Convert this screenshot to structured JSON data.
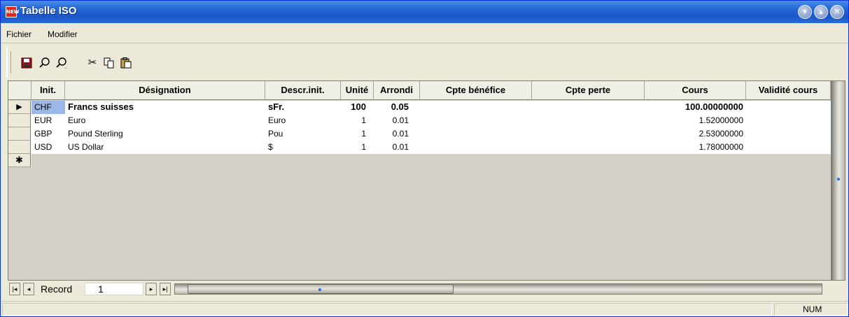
{
  "window": {
    "title": "Tabelle ISO",
    "icon_text": "NEW"
  },
  "menu": {
    "items": [
      "Fichier",
      "Modifier"
    ]
  },
  "toolbar": {
    "buttons": [
      "save-icon",
      "find-icon",
      "find-next-icon",
      "cut-icon",
      "copy-icon",
      "paste-icon"
    ]
  },
  "grid": {
    "columns": [
      "Init.",
      "Désignation",
      "Descr.init.",
      "Unité",
      "Arrondi",
      "Cpte bénéfice",
      "Cpte perte",
      "Cours",
      "Validité cours"
    ],
    "rows": [
      {
        "init": "CHF",
        "designation": "Francs suisses",
        "descr": "sFr.",
        "unite": "100",
        "arrondi": "0.05",
        "benefice": "",
        "perte": "",
        "cours": "100.00000000",
        "validite": ""
      },
      {
        "init": "EUR",
        "designation": "Euro",
        "descr": "Euro",
        "unite": "1",
        "arrondi": "0.01",
        "benefice": "",
        "perte": "",
        "cours": "1.52000000",
        "validite": ""
      },
      {
        "init": "GBP",
        "designation": "Pound Sterling",
        "descr": "Pou",
        "unite": "1",
        "arrondi": "0.01",
        "benefice": "",
        "perte": "",
        "cours": "2.53000000",
        "validite": ""
      },
      {
        "init": "USD",
        "designation": "US Dollar",
        "descr": "$",
        "unite": "1",
        "arrondi": "0.01",
        "benefice": "",
        "perte": "",
        "cours": "1.78000000",
        "validite": ""
      }
    ],
    "current_row_marker": "▶",
    "new_row_marker": "✱"
  },
  "navigation": {
    "label": "Record",
    "value": "1"
  },
  "status": {
    "num": "NUM"
  }
}
